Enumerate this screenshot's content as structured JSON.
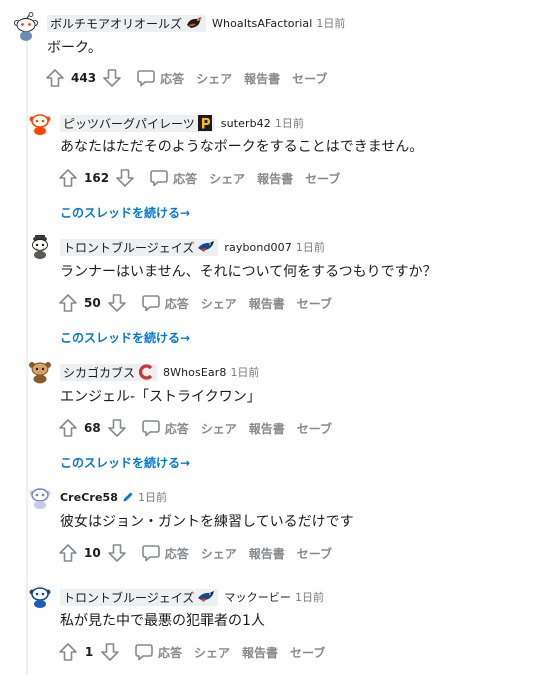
{
  "comments": [
    {
      "flair": "ボルチモアオリオールズ",
      "flair_icon": "orioles-bird-icon",
      "username": "WhoaItsAFactorial",
      "time": "1日前",
      "body": "ボーク。",
      "score": "443",
      "avatar": "snoo-default-avatar"
    },
    {
      "flair": "ピッツバーグパイレーツ",
      "flair_icon": "pirates-p-icon",
      "username": "suterb42",
      "time": "1日前",
      "body": "あなたはただそのようなボークをすることはできません。",
      "score": "162",
      "continue": "このスレッドを続ける→",
      "avatar": "snoo-red-avatar"
    },
    {
      "flair": "トロントブルージェイズ",
      "flair_icon": "bluejays-bird-icon",
      "username": "raybond007",
      "time": "1日前",
      "body": "ランナーはいません、それについて何をするつもりですか？",
      "score": "50",
      "continue": "このスレッドを続ける→",
      "avatar": "snoo-hat-avatar"
    },
    {
      "flair": "シカゴカブス",
      "flair_icon": "cubs-c-icon",
      "username": "8WhosEar8",
      "time": "1日前",
      "body": "エンジェル-「ストライクワン」",
      "score": "68",
      "continue": "このスレッドを続ける→",
      "avatar": "snoo-brown-avatar"
    },
    {
      "username": "CreCre58",
      "time": "1日前",
      "body": "彼女はジョン・ガントを練習しているだけです",
      "score": "10",
      "avatar": "snoo-blue-avatar",
      "user_icon": "pencil-icon"
    },
    {
      "flair": "トロントブルージェイズ",
      "flair_icon": "bluejays-bird-icon",
      "username": "マックービー",
      "time": "1日前",
      "body": "私が見た中で最悪の犯罪者の1人",
      "score": "1",
      "avatar": "snoo-bluejays-avatar"
    }
  ],
  "actions": {
    "reply": "応答",
    "share": "シェア",
    "report": "報告書",
    "save": "セーブ"
  },
  "colors": {
    "orioles": "#df4601",
    "pirates": "#fdb827",
    "bluejays": "#134a8e",
    "cubs": "#cc3433",
    "link": "#0079d3",
    "meta_gray": "#7c7c7c",
    "icon_gray": "#878a8c"
  }
}
